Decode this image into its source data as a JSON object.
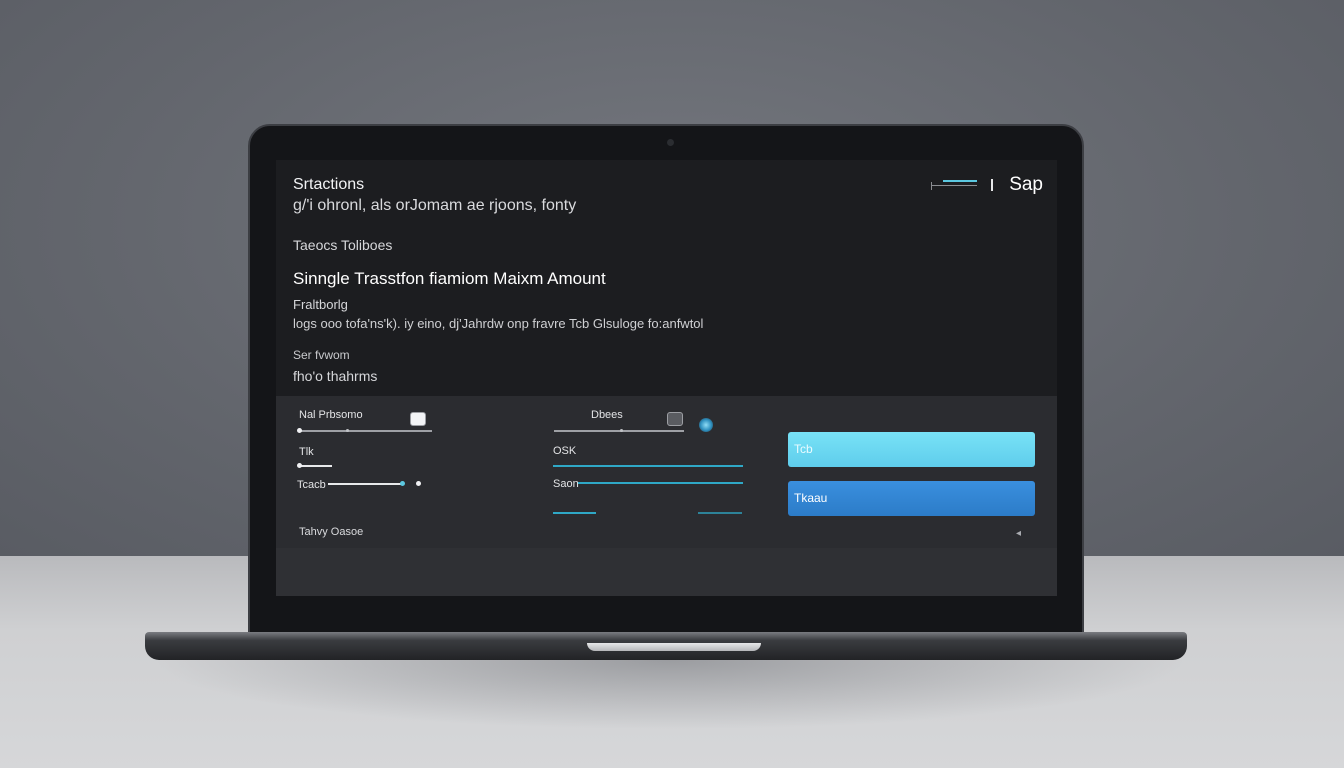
{
  "app": {
    "title": "Srtactions",
    "subtitle": "g/'i ohronl, als orJomam ae rjoons, fonty",
    "brand": "Sap"
  },
  "section": {
    "label": "Taeocs Toliboes",
    "heading": "Sinngle Trasstfon fiamiom Maixm  Amount",
    "field_label": "Fraltborlg",
    "field_description": "logs ooo tofa'ns'k). iy eino, dj'Jahrdw onp fravre Tcb Glsuloge  fo:anfwtol",
    "sub_label": "Ser fvwom",
    "sub_value": "fho'o thahrms"
  },
  "controls": {
    "left": {
      "slider1_label": "Nal Prbsomo",
      "slider2_label": "Tlk",
      "slider3_label": "Tcacb"
    },
    "middle": {
      "slider1_label": "Dbees",
      "slider2_label": "OSK",
      "slider3_label": "Saon"
    },
    "buttons": {
      "primary_label": "Tcb",
      "secondary_label": "Tkaau"
    }
  },
  "footer": {
    "text": "Tahvy Oasoe"
  },
  "colors": {
    "accent_light": "#66d3ee",
    "accent_blue": "#2f82cf",
    "screen_bg": "#1e1f22"
  }
}
